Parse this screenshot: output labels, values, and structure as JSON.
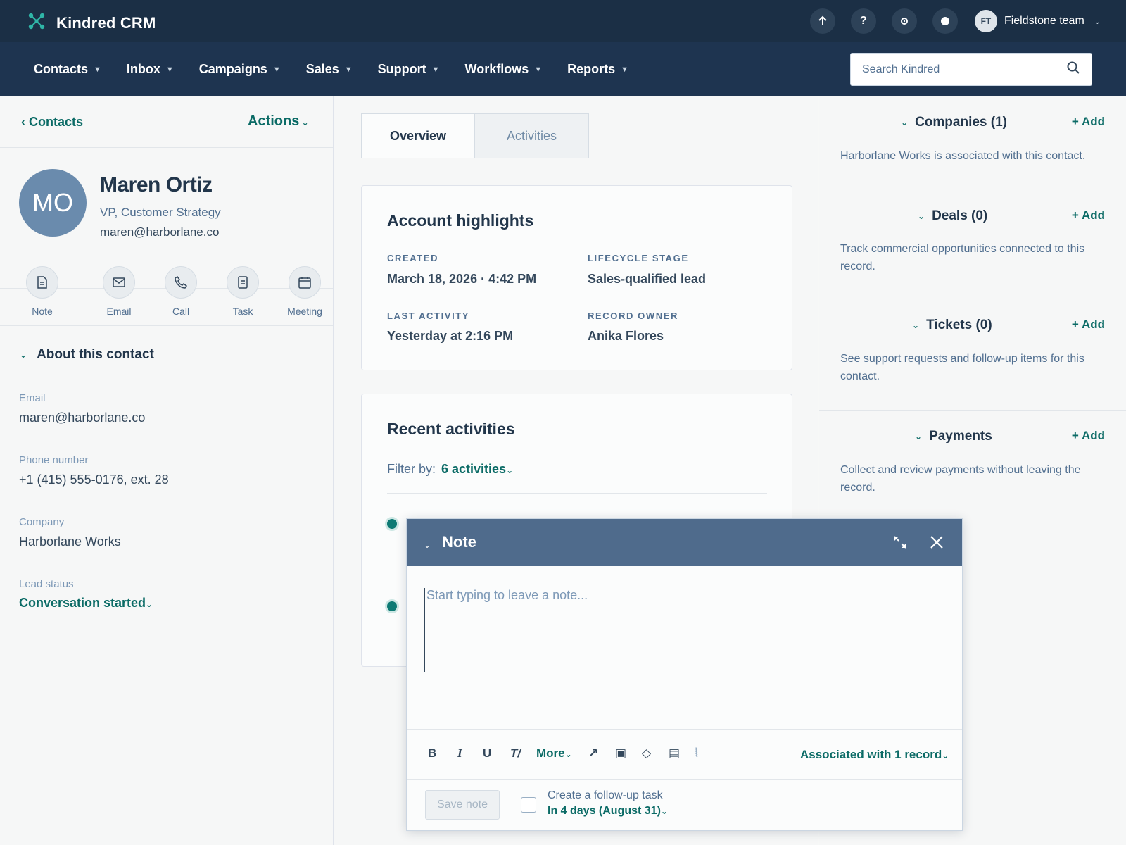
{
  "app": {
    "name": "Kindred CRM"
  },
  "account": {
    "initials": "FT",
    "team": "Fieldstone team"
  },
  "topbar": {
    "upgrade_icon": "up-arrow-icon",
    "help_label": "?",
    "settings_icon": "gear-icon",
    "status_icon": "status-dot-icon"
  },
  "nav": {
    "items": [
      {
        "label": "Contacts"
      },
      {
        "label": "Inbox"
      },
      {
        "label": "Campaigns"
      },
      {
        "label": "Sales"
      },
      {
        "label": "Support"
      },
      {
        "label": "Workflows"
      },
      {
        "label": "Reports"
      }
    ],
    "search_placeholder": "Search Kindred"
  },
  "left": {
    "back_label": "‹ Contacts",
    "actions_label": "Actions",
    "contact": {
      "initials": "MO",
      "name": "Maren Ortiz",
      "title": "VP, Customer Strategy",
      "email": "maren@harborlane.co"
    },
    "quick_actions": [
      {
        "label": "Note",
        "icon": "note-icon"
      },
      {
        "label": "Email",
        "icon": "email-icon"
      },
      {
        "label": "Call",
        "icon": "phone-icon"
      },
      {
        "label": "Task",
        "icon": "task-icon"
      },
      {
        "label": "Meeting",
        "icon": "calendar-icon"
      }
    ],
    "about": {
      "heading": "About this contact",
      "fields": [
        {
          "label": "Email",
          "value": "maren@harborlane.co"
        },
        {
          "label": "Phone number",
          "value": "+1 (415) 555-0176, ext. 28"
        },
        {
          "label": "Company",
          "value": "Harborlane Works"
        },
        {
          "label": "Lead status",
          "value": "Conversation started"
        }
      ]
    }
  },
  "main": {
    "tabs": [
      {
        "label": "Overview",
        "active": true
      },
      {
        "label": "Activities",
        "active": false
      }
    ],
    "highlights": {
      "title": "Account highlights",
      "created_label": "CREATED",
      "created_value": "March 18, 2026 · 4:42 PM",
      "lifecycle_label": "LIFECYCLE STAGE",
      "lifecycle_value": "Sales-qualified lead",
      "last_activity_label": "LAST ACTIVITY",
      "last_activity_value": "Yesterday at 2:16 PM",
      "owner_label": "RECORD OWNER",
      "owner_value": "Anika Flores"
    },
    "activities": {
      "title": "Recent activities",
      "filter_label": "Filter by:",
      "filter_value": "6 activities"
    }
  },
  "right": {
    "sections": [
      {
        "title": "Companies (1)",
        "add": "+ Add",
        "desc": "Harborlane Works is associated with this contact."
      },
      {
        "title": "Deals (0)",
        "add": "+ Add",
        "desc": "Track commercial opportunities connected to this record."
      },
      {
        "title": "Tickets (0)",
        "add": "+ Add",
        "desc": "See support requests and follow-up items for this contact."
      },
      {
        "title": "Payments",
        "add": "+ Add",
        "desc": "Collect and review payments without leaving the record."
      }
    ]
  },
  "note_modal": {
    "title": "Note",
    "placeholder": "Start typing to leave a note...",
    "toolbar": {
      "bold": "B",
      "italic": "I",
      "underline": "U",
      "clear_format": "T/",
      "more": "More",
      "associated": "Associated with 1 record"
    },
    "save_label": "Save note",
    "followup_label": "Create a follow-up task",
    "followup_value": "In 4 days (August 31)"
  },
  "colors": {
    "header": "#1b2f45",
    "nav": "#1e3450",
    "accent": "#0b6b66",
    "modal_header": "#4f6b8c",
    "avatar": "#6a8bad"
  }
}
